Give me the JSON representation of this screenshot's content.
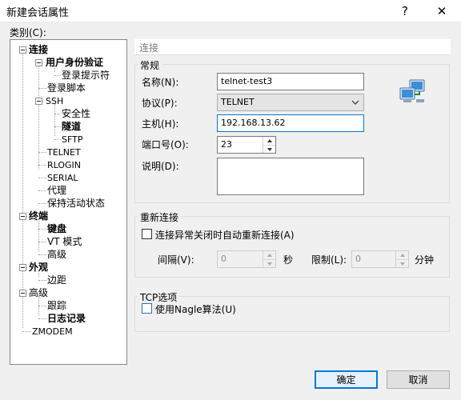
{
  "window": {
    "title": "新建会话属性",
    "help_glyph": "?",
    "close_glyph": "✕"
  },
  "category_label": "类别(C):",
  "tree": {
    "connection": "连接",
    "user_auth": "用户身份验证",
    "login_prompts": "登录提示符",
    "login_script": "登录脚本",
    "ssh": "SSH",
    "security": "安全性",
    "tunnel": "隧道",
    "sftp": "SFTP",
    "telnet": "TELNET",
    "rlogin": "RLOGIN",
    "serial": "SERIAL",
    "proxy": "代理",
    "keepalive": "保持活动状态",
    "terminal": "终端",
    "keyboard": "键盘",
    "vt_mode": "VT 模式",
    "advanced_term": "高级",
    "appearance": "外观",
    "margins": "边距",
    "advanced": "高级",
    "trace": "跟踪",
    "logging": "日志记录",
    "zmodem": "ZMODEM"
  },
  "panel": {
    "title": "连接",
    "general": {
      "title": "常规",
      "name_label": "名称(N):",
      "name_value": "telnet-test3",
      "protocol_label": "协议(P):",
      "protocol_value": "TELNET",
      "host_label": "主机(H):",
      "host_value": "192.168.13.62",
      "port_label": "端口号(O):",
      "port_value": "23",
      "desc_label": "说明(D):",
      "desc_value": ""
    },
    "reconnect": {
      "title": "重新连接",
      "auto_label": "连接异常关闭时自动重新连接(A)",
      "auto_checked": false,
      "interval_label": "间隔(V):",
      "interval_value": "0",
      "interval_unit": "秒",
      "limit_label": "限制(L):",
      "limit_value": "0",
      "limit_unit": "分钟"
    },
    "tcp": {
      "title": "TCP选项",
      "nagle_label": "使用Nagle算法(U)",
      "nagle_checked": false
    }
  },
  "buttons": {
    "ok": "确定",
    "cancel": "取消"
  },
  "colors": {
    "focus": "#0078d7",
    "window_bg": "#f0f0f0"
  },
  "icons": {
    "session": "network-computers-icon",
    "dropdown": "chevron-down-icon"
  }
}
